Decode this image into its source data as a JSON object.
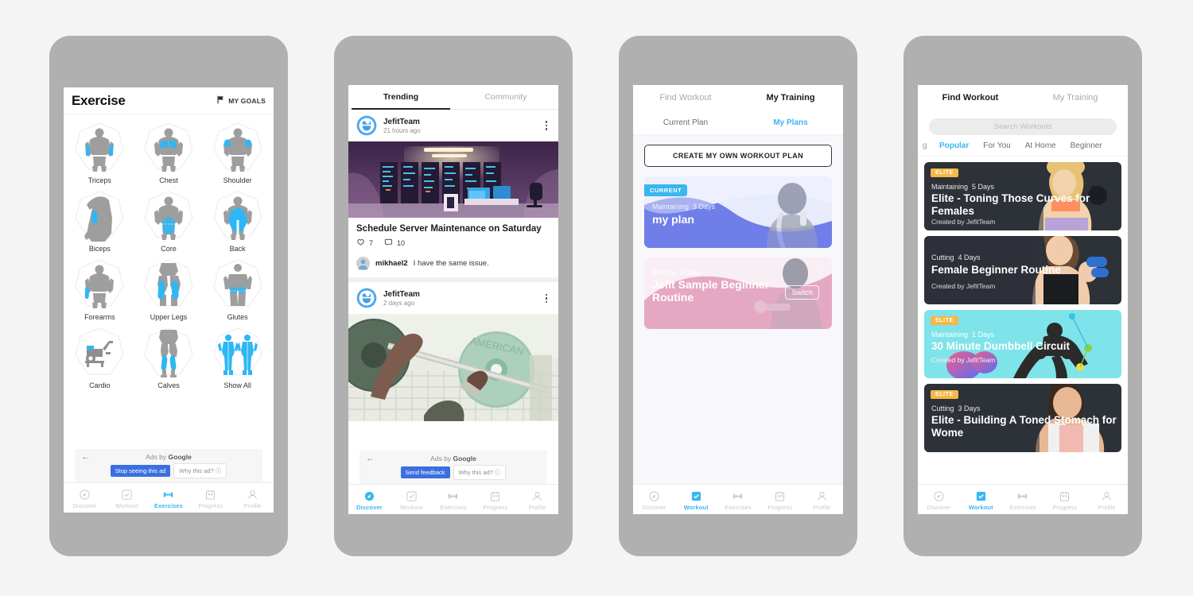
{
  "canvas": {
    "background": "#f4f4f4",
    "frame_color": "#b0b0b0"
  },
  "phone1": {
    "header": {
      "title": "Exercise",
      "goals_label": "MY GOALS",
      "goals_icon": "flag-icon"
    },
    "exercises": [
      {
        "label": "Triceps",
        "icon": "body-triceps-icon"
      },
      {
        "label": "Chest",
        "icon": "body-chest-icon"
      },
      {
        "label": "Shoulder",
        "icon": "body-shoulder-icon"
      },
      {
        "label": "Biceps",
        "icon": "body-biceps-icon"
      },
      {
        "label": "Core",
        "icon": "body-core-icon"
      },
      {
        "label": "Back",
        "icon": "body-back-icon"
      },
      {
        "label": "Forearms",
        "icon": "body-forearms-icon"
      },
      {
        "label": "Upper Legs",
        "icon": "body-upperlegs-icon"
      },
      {
        "label": "Glutes",
        "icon": "body-glutes-icon"
      },
      {
        "label": "Cardio",
        "icon": "cardio-bike-icon"
      },
      {
        "label": "Calves",
        "icon": "body-calves-icon"
      },
      {
        "label": "Show All",
        "icon": "body-showall-icon"
      }
    ],
    "ad": {
      "back_icon": "arrow-left-icon",
      "label": "Ads by ",
      "brand": "Google",
      "stop_button": "Stop seeing this ad",
      "why_button": "Why this ad? ⓘ"
    },
    "nav": {
      "items": [
        {
          "label": "Discover",
          "icon": "compass-icon",
          "active": false
        },
        {
          "label": "Workout",
          "icon": "check-square-icon",
          "active": false
        },
        {
          "label": "Exercises",
          "icon": "dumbbell-icon",
          "active": true
        },
        {
          "label": "Progress",
          "icon": "calendar-icon",
          "active": false
        },
        {
          "label": "Profile",
          "icon": "person-icon",
          "active": false
        }
      ]
    }
  },
  "phone2": {
    "tabs": [
      {
        "label": "Trending",
        "active": true
      },
      {
        "label": "Community",
        "active": false
      }
    ],
    "posts": [
      {
        "user": "JefitTeam",
        "time": "21 hours ago",
        "avatar_icon": "jefit-logo-icon",
        "menu_icon": "kebab-menu-icon",
        "image_alt": "server-room-illustration",
        "title": "Schedule Server Maintenance on Saturday",
        "likes": "7",
        "comments": "10",
        "like_icon": "heart-icon",
        "comment_icon": "comment-bubble-icon",
        "top_comment": {
          "user": "mikhael2",
          "text": "I have the same issue.",
          "avatar_icon": "user-avatar-icon"
        }
      },
      {
        "user": "JefitTeam",
        "time": "2 days ago",
        "avatar_icon": "jefit-logo-icon",
        "menu_icon": "kebab-menu-icon",
        "image_alt": "barbell-bench-press-photo"
      }
    ],
    "ad": {
      "back_icon": "arrow-left-icon",
      "label": "Ads by ",
      "brand": "Google",
      "stop_button": "Send feedback",
      "why_button": "Why this ad? ⓘ"
    },
    "nav": {
      "items": [
        {
          "label": "Discover",
          "icon": "compass-icon",
          "active": true
        },
        {
          "label": "Workout",
          "icon": "check-square-icon",
          "active": false
        },
        {
          "label": "Exercises",
          "icon": "dumbbell-icon",
          "active": false
        },
        {
          "label": "Progress",
          "icon": "calendar-icon",
          "active": false
        },
        {
          "label": "Profile",
          "icon": "person-icon",
          "active": false
        }
      ]
    }
  },
  "phone3": {
    "segments": [
      {
        "label": "Find Workout",
        "active": false
      },
      {
        "label": "My Training",
        "active": true
      }
    ],
    "subtabs": [
      {
        "label": "Current Plan",
        "active": false
      },
      {
        "label": "My Plans",
        "active": true
      }
    ],
    "create_button": "CREATE MY OWN WORKOUT PLAN",
    "plans": [
      {
        "badge": "CURRENT",
        "goal": "Maintaining",
        "days": "3 Days",
        "title": "my plan",
        "menu_icon": "dots-horizontal-icon",
        "theme": "#6f7ee8"
      },
      {
        "badge": "",
        "goal": "Bulking",
        "days": "4 Days",
        "title": "Jefit Sample Beginner Routine",
        "menu_icon": "dots-horizontal-icon",
        "switch_button": "Switch",
        "theme": "#e5a8c2"
      }
    ],
    "nav": {
      "items": [
        {
          "label": "Discover",
          "icon": "compass-icon",
          "active": false
        },
        {
          "label": "Workout",
          "icon": "check-square-icon",
          "active": true
        },
        {
          "label": "Exercises",
          "icon": "dumbbell-icon",
          "active": false
        },
        {
          "label": "Progress",
          "icon": "calendar-icon",
          "active": false
        },
        {
          "label": "Profile",
          "icon": "person-icon",
          "active": false
        }
      ]
    }
  },
  "phone4": {
    "segments": [
      {
        "label": "Find Workout",
        "active": true
      },
      {
        "label": "My Training",
        "active": false
      }
    ],
    "search_placeholder": "Search Workouts",
    "filters": [
      {
        "label": "g",
        "active": false,
        "cut": true
      },
      {
        "label": "Popular",
        "active": true,
        "cut": false
      },
      {
        "label": "For You",
        "active": false,
        "cut": false
      },
      {
        "label": "At Home",
        "active": false,
        "cut": false
      },
      {
        "label": "Beginner",
        "active": false,
        "cut": false
      }
    ],
    "workouts": [
      {
        "elite": "ELITE",
        "goal": "Maintaining",
        "days": "5 Days",
        "title": "Elite - Toning Those Curves for Females",
        "creator": "Created by JefitTeam",
        "theme": "dark"
      },
      {
        "elite": "",
        "goal": "Cutting",
        "days": "4 Days",
        "title": "Female Beginner Routine",
        "creator": "Created by JefitTeam",
        "theme": "dark"
      },
      {
        "elite": "ELITE",
        "goal": "Maintaining",
        "days": "1 Days",
        "title": "30 Minute Dumbbell Circuit",
        "creator": "Created by JefitTeam",
        "theme": "cyan"
      },
      {
        "elite": "ELITE",
        "goal": "Cutting",
        "days": "3 Days",
        "title": "Elite - Building A Toned Stomach for Wome",
        "creator": "",
        "theme": "dark"
      }
    ],
    "nav": {
      "items": [
        {
          "label": "Discover",
          "icon": "compass-icon",
          "active": false
        },
        {
          "label": "Workout",
          "icon": "check-square-icon",
          "active": true
        },
        {
          "label": "Exercises",
          "icon": "dumbbell-icon",
          "active": false
        },
        {
          "label": "Progress",
          "icon": "calendar-icon",
          "active": false
        },
        {
          "label": "Profile",
          "icon": "person-icon",
          "active": false
        }
      ]
    }
  }
}
